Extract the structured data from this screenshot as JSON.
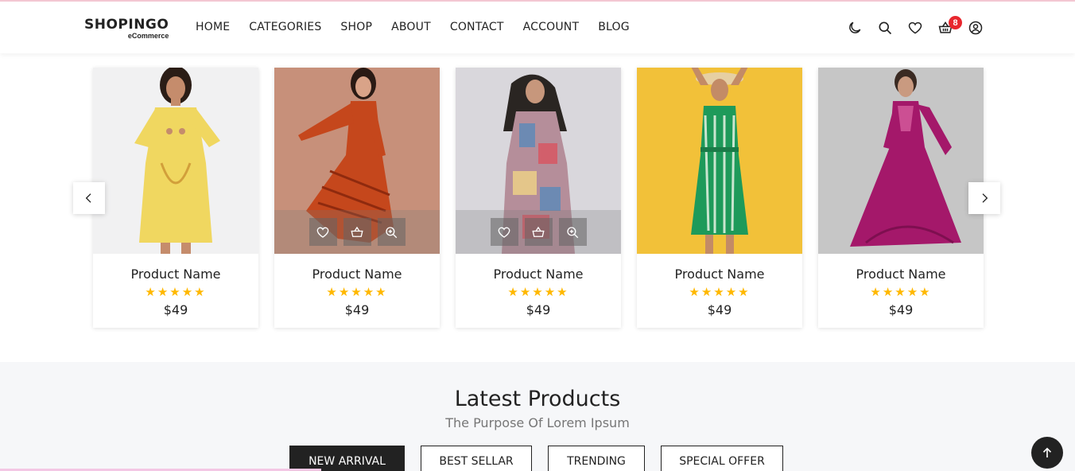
{
  "brand": {
    "name": "SHOPINGO",
    "tagline": "eCommerce"
  },
  "nav": [
    "HOME",
    "CATEGORIES",
    "SHOP",
    "ABOUT",
    "CONTACT",
    "ACCOUNT",
    "BLOG"
  ],
  "header_icons": [
    "moon-icon",
    "search-icon",
    "heart-icon",
    "basket-icon",
    "user-icon"
  ],
  "cart_count": "8",
  "products": [
    {
      "name": "Product Name",
      "rating": 5,
      "stars": "★★★★★",
      "price": "$49",
      "image": "woman-yellow-kurta",
      "actions_visible": false
    },
    {
      "name": "Product Name",
      "rating": 5,
      "stars": "★★★★★",
      "price": "$49",
      "image": "woman-red-printed-dress",
      "actions_visible": true
    },
    {
      "name": "Product Name",
      "rating": 5,
      "stars": "★★★★★",
      "price": "$49",
      "image": "woman-patchwork-tunic",
      "actions_visible": true
    },
    {
      "name": "Product Name",
      "rating": 5,
      "stars": "★★★★★",
      "price": "$49",
      "image": "woman-green-striped-dress",
      "actions_visible": false
    },
    {
      "name": "Product Name",
      "rating": 5,
      "stars": "★★★★★",
      "price": "$49",
      "image": "woman-magenta-gown",
      "actions_visible": false
    }
  ],
  "latest": {
    "title": "Latest Products",
    "subtitle": "The Purpose Of Lorem Ipsum",
    "tabs": [
      "NEW ARRIVAL",
      "BEST SELLAR",
      "TRENDING",
      "SPECIAL OFFER"
    ],
    "active_tab": "NEW ARRIVAL"
  },
  "colors": {
    "accent_dark": "#222222",
    "star": "#ffb800",
    "badge": "#e8272e",
    "section_bg": "#f6f7f9"
  }
}
